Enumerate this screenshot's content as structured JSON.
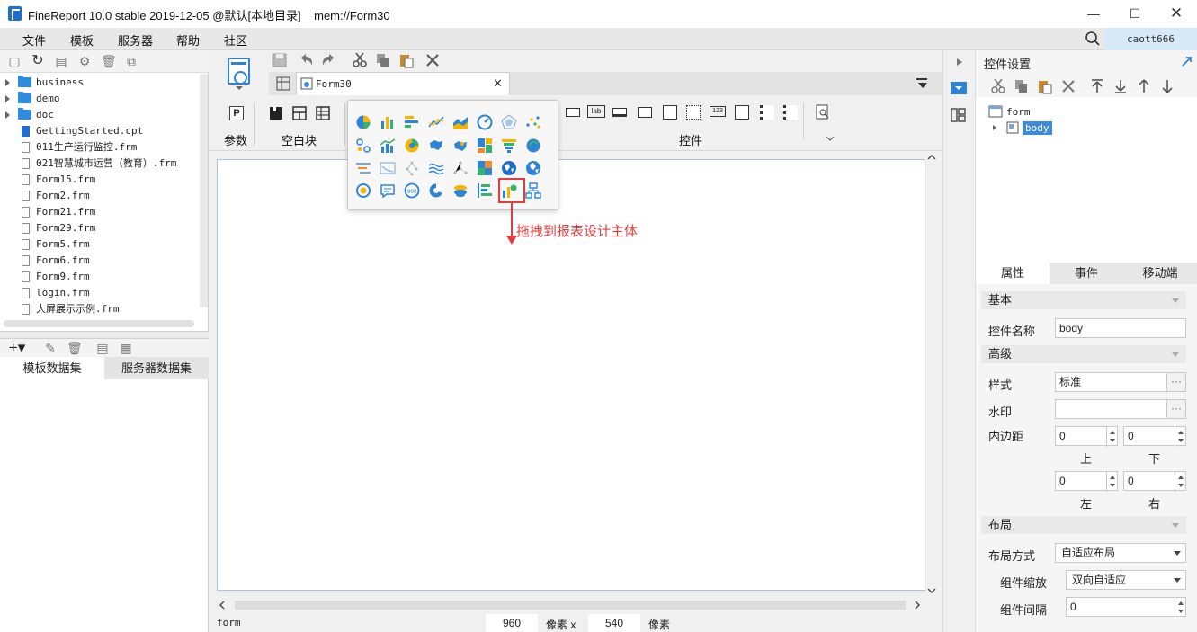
{
  "window": {
    "title": "FineReport 10.0 stable 2019-12-05 @默认[本地目录]    mem://Form30"
  },
  "menu": [
    "文件",
    "模板",
    "服务器",
    "帮助",
    "社区"
  ],
  "user": "caott666",
  "tree": [
    {
      "label": "business",
      "kind": "folder"
    },
    {
      "label": "demo",
      "kind": "folder"
    },
    {
      "label": "doc",
      "kind": "folder"
    },
    {
      "label": "GettingStarted.cpt",
      "kind": "cpt"
    },
    {
      "label": "011生产运行监控.frm",
      "kind": "file"
    },
    {
      "label": "021智慧城市运营（教育）.frm",
      "kind": "file"
    },
    {
      "label": "Form15.frm",
      "kind": "file"
    },
    {
      "label": "Form2.frm",
      "kind": "file"
    },
    {
      "label": "Form21.frm",
      "kind": "file"
    },
    {
      "label": "Form29.frm",
      "kind": "file"
    },
    {
      "label": "Form5.frm",
      "kind": "file"
    },
    {
      "label": "Form6.frm",
      "kind": "file"
    },
    {
      "label": "Form9.frm",
      "kind": "file"
    },
    {
      "label": "login.frm",
      "kind": "file"
    },
    {
      "label": "大屏展示示例.frm",
      "kind": "file"
    }
  ],
  "dataset_tabs": [
    "模板数据集",
    "服务器数据集"
  ],
  "file_tab": "Form30",
  "groups": {
    "param": "参数",
    "blank": "空白块",
    "widget": "控件"
  },
  "annotation": "拖拽到报表设计主体",
  "status": {
    "widget": "form",
    "width": "960",
    "px1": "像素 x",
    "height": "540",
    "px2": "像素"
  },
  "right": {
    "header": "控件设置",
    "tree_root": "form",
    "tree_child": "body",
    "tabs": [
      "属性",
      "事件",
      "移动端"
    ],
    "sec_basic": "基本",
    "name_label": "控件名称",
    "name_value": "body",
    "sec_advanced": "高级",
    "style_label": "样式",
    "style_value": "标准",
    "watermark_label": "水印",
    "padding_label": "内边距",
    "pad_top": "0",
    "pad_bottom": "0",
    "pad_left": "0",
    "pad_right": "0",
    "lbl_top": "上",
    "lbl_bottom": "下",
    "lbl_left": "左",
    "lbl_right": "右",
    "sec_layout": "布局",
    "layout_label": "布局方式",
    "layout_value": "自适应布局",
    "scale_label": "组件缩放",
    "scale_value": "双向自适应",
    "gap_label": "组件间隔",
    "gap_value": "0",
    "dots": "···"
  },
  "colors": {
    "accent": "#2e84d4",
    "highlight": "#e23c3c",
    "badge": "#d7e8f7"
  }
}
